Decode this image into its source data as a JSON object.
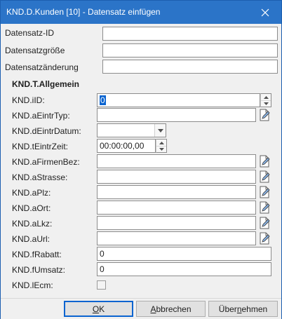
{
  "window": {
    "title": "KND.D.Kunden [10] - Datensatz einfügen"
  },
  "header_fields": [
    {
      "label": "Datensatz-ID",
      "value": ""
    },
    {
      "label": "Datensatzgröße",
      "value": ""
    },
    {
      "label": "Datensatzänderung",
      "value": ""
    }
  ],
  "group": {
    "title": "KND.T.Allgemein",
    "fields": {
      "ild": {
        "label": "KND.iID:",
        "value": "0"
      },
      "aEintrTyp": {
        "label": "KND.aEintrTyp:",
        "value": ""
      },
      "dEintrDatum": {
        "label": "KND.dEintrDatum:",
        "value": ""
      },
      "tEintrZeit": {
        "label": "KND.tEintrZeit:",
        "value": "00:00:00,00"
      },
      "aFirmenBez": {
        "label": "KND.aFirmenBez:",
        "value": ""
      },
      "aStrasse": {
        "label": "KND.aStrasse:",
        "value": ""
      },
      "aPlz": {
        "label": "KND.aPlz:",
        "value": ""
      },
      "aOrt": {
        "label": "KND.aOrt:",
        "value": ""
      },
      "aLkz": {
        "label": "KND.aLkz:",
        "value": ""
      },
      "aUrl": {
        "label": "KND.aUrl:",
        "value": ""
      },
      "fRabatt": {
        "label": "KND.fRabatt:",
        "value": "0"
      },
      "fUmsatz": {
        "label": "KND.fUmsatz:",
        "value": "0"
      },
      "lEcm": {
        "label": "KND.lEcm:",
        "checked": false
      }
    }
  },
  "buttons": {
    "ok": {
      "label_pre": "",
      "label_u": "O",
      "label_post": "K"
    },
    "cancel": {
      "label_pre": "",
      "label_u": "A",
      "label_post": "bbrechen"
    },
    "apply": {
      "label_pre": "Über",
      "label_u": "n",
      "label_post": "ehmen"
    }
  },
  "colors": {
    "titlebar": "#2b74c8",
    "selection": "#0a64d0"
  },
  "icons": [
    "close-icon",
    "spin-up-icon",
    "spin-down-icon",
    "edit-icon",
    "chevron-down-icon"
  ]
}
